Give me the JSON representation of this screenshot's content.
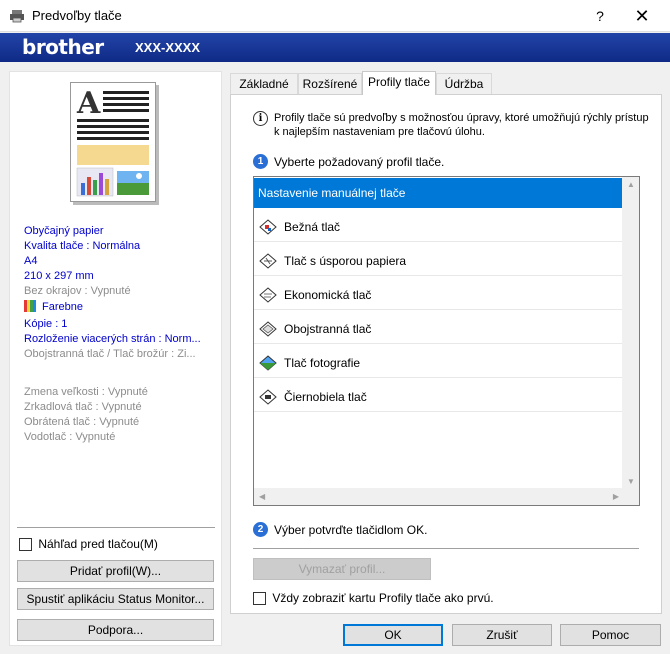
{
  "window": {
    "title": "Predvoľby tlače",
    "help_label": "?",
    "close_label": "✕"
  },
  "brand": {
    "logo": "brother",
    "model": "XXX-XXXX"
  },
  "summary": {
    "paper": "Obyčajný papier",
    "quality": "Kvalita tlače : Normálna",
    "size": "A4",
    "dims": "210 x 297 mm",
    "borderless": "Bez okrajov : Vypnuté",
    "color": "Farebne",
    "copies": "Kópie : 1",
    "layout": "Rozloženie viacerých strán : Norm...",
    "duplex": "Obojstranná tlač / Tlač brožúr : Zi...",
    "scaling": "Zmena veľkosti : Vypnuté",
    "mirror": "Zrkadlová tlač : Vypnuté",
    "reverse": "Obrátená tlač : Vypnuté",
    "watermark": "Vodotlač : Vypnuté"
  },
  "left_controls": {
    "preview_label": "Náhľad pred tlačou(M)",
    "add_profile": "Pridať profil(W)...",
    "status_monitor": "Spustiť aplikáciu Status Monitor...",
    "support": "Podpora..."
  },
  "tabs": [
    {
      "label": "Základné"
    },
    {
      "label": "Rozšírené"
    },
    {
      "label": "Profily tlače"
    },
    {
      "label": "Údržba"
    }
  ],
  "profiles_tab": {
    "description": "Profily tlače sú predvoľby s možnosťou úpravy, ktoré umožňujú rýchly prístup k najlepším nastaveniam pre tlačovú úlohu.",
    "step1_num": "1",
    "step1": "Vyberte požadovaný profil tlače.",
    "profiles": [
      {
        "label": "Nastavenie manuálnej tlače"
      },
      {
        "label": "Bežná tlač"
      },
      {
        "label": "Tlač s úsporou papiera"
      },
      {
        "label": "Ekonomická tlač"
      },
      {
        "label": "Obojstranná tlač"
      },
      {
        "label": "Tlač fotografie"
      },
      {
        "label": "Čiernobiela tlač"
      }
    ],
    "step2_num": "2",
    "step2": "Výber potvrďte tlačidlom OK.",
    "delete_profile": "Vymazať profil...",
    "always_show": "Vždy zobraziť kartu Profily tlače ako prvú."
  },
  "footer": {
    "ok": "OK",
    "cancel": "Zrušiť",
    "help": "Pomoc"
  }
}
